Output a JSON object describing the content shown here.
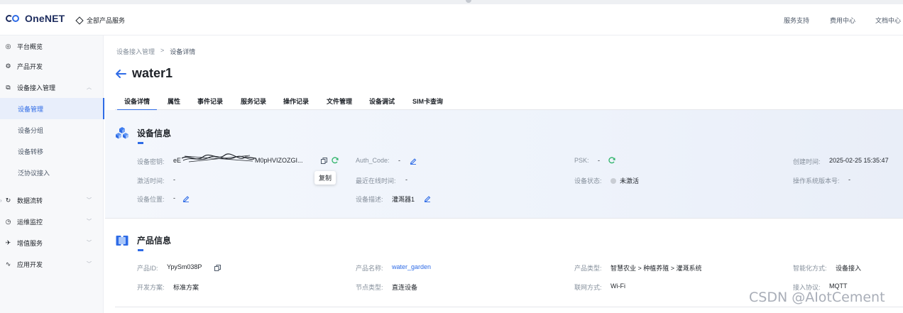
{
  "header": {
    "logo_text": "OneNET",
    "all_services": "全部产品服务",
    "nav": [
      "服务支持",
      "费用中心",
      "文档中心"
    ]
  },
  "sidebar": {
    "items": [
      {
        "label": "平台概览",
        "icon": "platform-icon"
      },
      {
        "label": "产品开发",
        "icon": "product-dev-icon"
      },
      {
        "label": "设备接入管理",
        "icon": "device-access-icon"
      }
    ],
    "sub_items": [
      "设备管理",
      "设备分组",
      "设备转移",
      "泛协议接入"
    ],
    "lower_items": [
      {
        "label": "数据流转",
        "icon": "data-flow-icon"
      },
      {
        "label": "运维监控",
        "icon": "monitor-icon"
      },
      {
        "label": "增值服务",
        "icon": "value-added-icon"
      },
      {
        "label": "应用开发",
        "icon": "app-dev-icon"
      }
    ]
  },
  "breadcrumb": {
    "parent": "设备接入管理",
    "sep": ">",
    "current": "设备详情"
  },
  "title": "water1",
  "tabs": [
    "设备详情",
    "属性",
    "事件记录",
    "服务记录",
    "操作记录",
    "文件管理",
    "设备调试",
    "SIM卡查询"
  ],
  "device_info": {
    "heading": "设备信息",
    "key_label": "设备密钥:",
    "key_value_start": "eE",
    "key_value_end": "M0pHVIZOZGI...",
    "auth_label": "Auth_Code:",
    "auth_value": "-",
    "psk_label": "PSK:",
    "psk_value": "-",
    "created_label": "创建时间:",
    "created_value": "2025-02-25 15:35:47",
    "activated_label": "激活时间:",
    "activated_value": "-",
    "last_online_label": "最近在线时间:",
    "last_online_value": "-",
    "status_label": "设备状态:",
    "status_value": "未激活",
    "os_label": "操作系统版本号:",
    "os_value": "-",
    "location_label": "设备位置:",
    "location_value": "-",
    "desc_label": "设备描述:",
    "desc_value": "灌溉器1",
    "tooltip": "复制"
  },
  "product_info": {
    "heading": "产品信息",
    "id_label": "产品ID:",
    "id_value": "YpySm038P",
    "name_label": "产品名称:",
    "name_value": "water_garden",
    "type_label": "产品类型:",
    "type_value": "智慧农业 > 种植养殖 > 灌溉系统",
    "smart_label": "智能化方式:",
    "smart_value": "设备接入",
    "dev_label": "开发方案:",
    "dev_value": "标准方案",
    "node_label": "节点类型:",
    "node_value": "直连设备",
    "net_label": "联网方式:",
    "net_value": "Wi-Fi",
    "protocol_label": "接入协议:",
    "protocol_value": "MQTT"
  },
  "watermark": "CSDN @AIotCement",
  "colors": {
    "accent": "#2e6be6",
    "green": "#2fb46a"
  }
}
